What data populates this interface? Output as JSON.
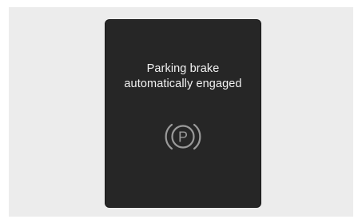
{
  "warning": {
    "line1": "Parking brake",
    "line2": "automatically engaged",
    "icon": "parking-brake-icon",
    "icon_letter": "P"
  },
  "colors": {
    "panel": "#262626",
    "text": "#f2f2f2",
    "icon": "#9a9a9a",
    "backdrop": "#ececec"
  }
}
